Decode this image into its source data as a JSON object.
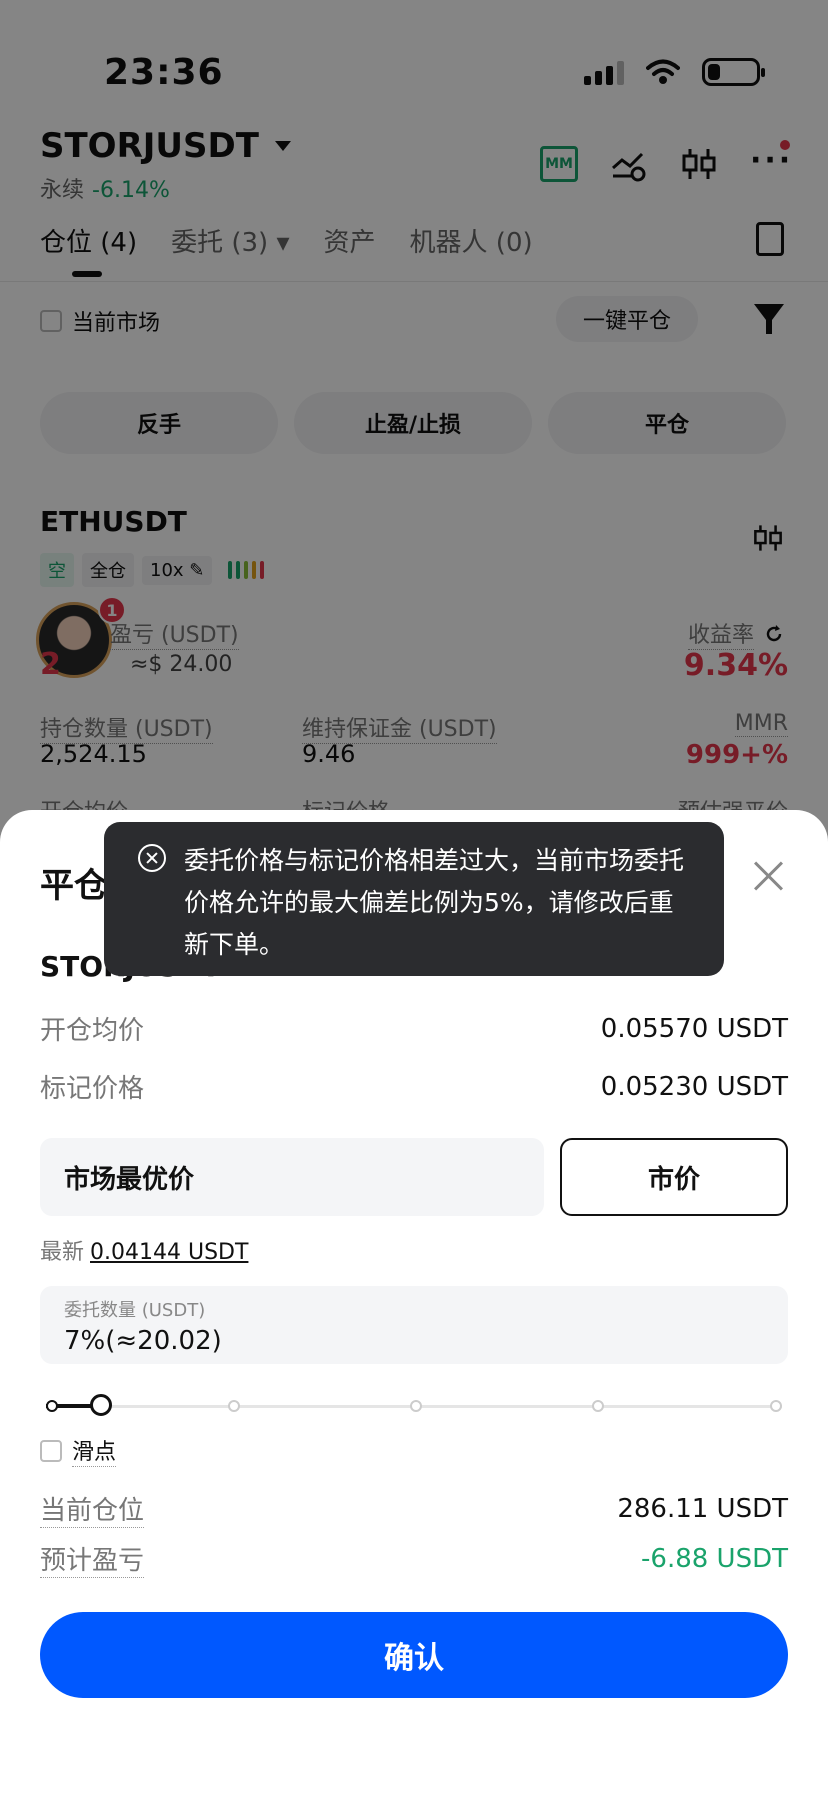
{
  "status_bar": {
    "time": "23:36"
  },
  "header": {
    "symbol": "STORJUSDT",
    "type": "永续",
    "change": "-6.14%",
    "mm_label": "MM"
  },
  "tabs": [
    {
      "label": "仓位 (4)"
    },
    {
      "label": "委托 (3) ▾"
    },
    {
      "label": "资产"
    },
    {
      "label": "机器人 (0)"
    }
  ],
  "filter": {
    "current_market": "当前市场",
    "close_all": "一键平仓"
  },
  "actions": {
    "reverse": "反手",
    "tpsl": "止盈/止损",
    "close": "平仓"
  },
  "position": {
    "symbol": "ETHUSDT",
    "side": "空",
    "margin_mode": "全仓",
    "leverage": "10x ✎",
    "pnl_label": "盈亏 (USDT)",
    "pnl_value": "2",
    "pnl_usd": "≈$ 24.00",
    "roe_label": "收益率",
    "roe_value": "9.34%",
    "size_label": "持仓数量 (USDT)",
    "size_value": "2,524.15",
    "mm_label": "维持保证金 (USDT)",
    "mm_value": "9.46",
    "mmr_label": "MMR",
    "mmr_value": "999+%",
    "entry_label": "开仓均价",
    "mark_label": "标记价格",
    "liq_label": "预估强平价",
    "avatar_badge": "1"
  },
  "sheet": {
    "title": "平仓",
    "symbol": "STORJUSDT",
    "entry_label": "开仓均价",
    "entry_value": "0.05570 USDT",
    "mark_label": "标记价格",
    "mark_value": "0.05230 USDT",
    "price_input": "市场最优价",
    "market_button": "市价",
    "latest_label": "最新",
    "latest_value": "0.04144 USDT",
    "qty_label": "委托数量 (USDT)",
    "qty_value": "7%(≈20.02)",
    "slider_percent": 7,
    "slippage_label": "滑点",
    "current_pos_label": "当前仓位",
    "current_pos_value": "286.11 USDT",
    "est_pnl_label": "预计盈亏",
    "est_pnl_value": "-6.88 USDT",
    "confirm": "确认"
  },
  "toast": {
    "message": "委托价格与标记价格相差过大，当前市场委托价格允许的最大偏差比例为5%，请修改后重新下单。"
  },
  "colors": {
    "green": "#1aa36b",
    "red": "#e5374c",
    "primary": "#0058ff"
  }
}
